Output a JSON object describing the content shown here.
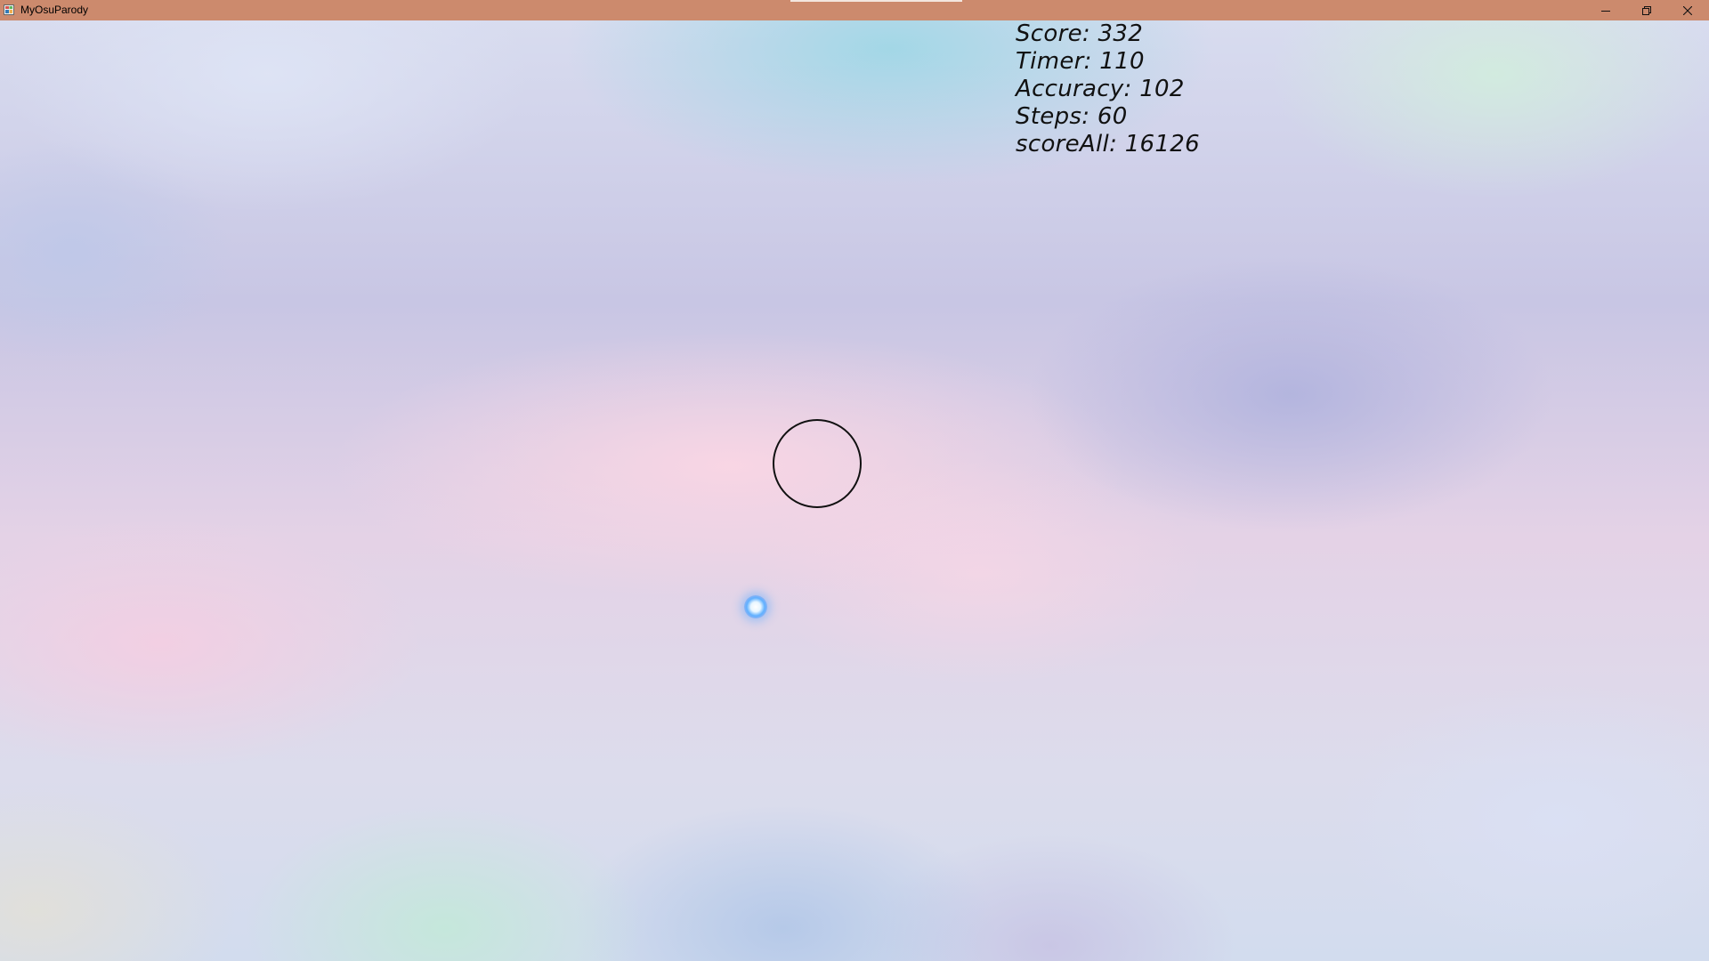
{
  "window": {
    "title": "MyOsuParody",
    "app_icon": "app-window-icon",
    "controls": {
      "minimize_icon": "minimize-icon",
      "restore_icon": "restore-icon",
      "close_icon": "close-icon"
    },
    "titlebar_color": "#cc8a6d"
  },
  "hud": {
    "score_label": "Score:",
    "score_value": "332",
    "timer_label": "Timer:",
    "timer_value": "110",
    "accuracy_label": "Accuracy:",
    "accuracy_value": "102",
    "steps_label": "Steps:",
    "steps_value": "60",
    "scoreall_label": "scoreAll:",
    "scoreall_value": "16126"
  },
  "game": {
    "target_shape": "circle",
    "cursor_color": "#5fb0ff"
  }
}
